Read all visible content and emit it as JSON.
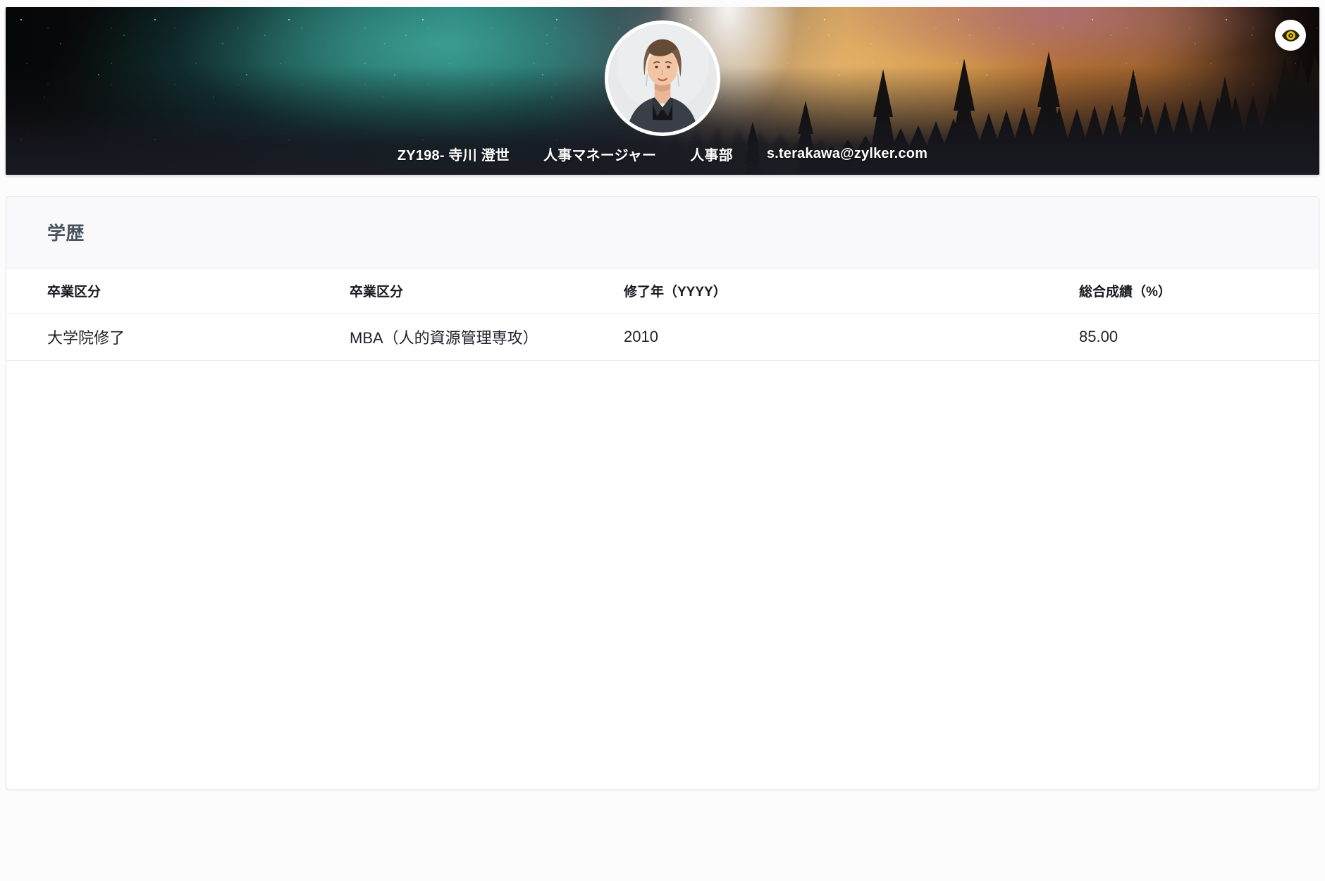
{
  "banner": {
    "profile": {
      "id_name": "ZY198- 寺川 澄世",
      "role": "人事マネージャー",
      "department": "人事部",
      "email": "s.terakawa@zylker.com"
    },
    "eye_icon": {
      "name": "eye-icon",
      "accent_color": "#e9c51a"
    }
  },
  "education": {
    "title": "学歴",
    "table": {
      "columns": [
        "卒業区分",
        "卒業区分",
        "修了年（YYYY）",
        "総合成績（%）"
      ],
      "rows": [
        {
          "graduation_type": "大学院修了",
          "major": "MBA（人的資源管理専攻）",
          "completion_year": "2010",
          "overall_grade": "85.00"
        }
      ]
    }
  }
}
